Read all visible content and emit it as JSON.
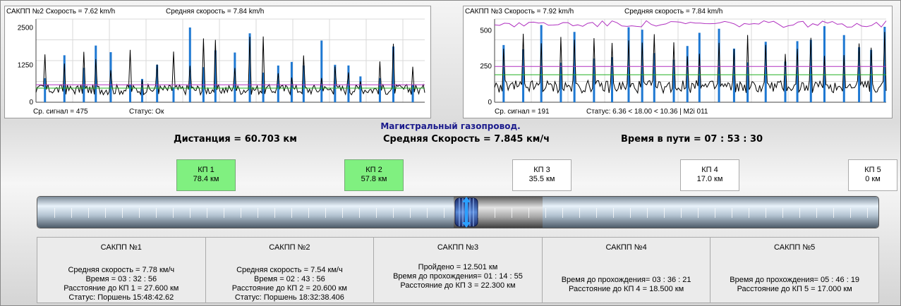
{
  "charts": [
    {
      "title_left": "САКПП №2  Скорость = 7.62 km/h",
      "title_right": "Средняя скорость = 7.84 km/h",
      "y_ticks": [
        "2500",
        "1250",
        "0"
      ],
      "y_max": 2800,
      "footer_signal": "Ср. сигнал = 475",
      "footer_status": "Статус: Ок"
    },
    {
      "title_left": "САКПП №3  Скорость = 7.92 km/h",
      "title_right": "Средняя скорость = 7.84 km/h",
      "y_ticks": [
        "500",
        "250",
        "0"
      ],
      "y_max": 580,
      "footer_signal": "Ср. сигнал = 191",
      "footer_status": "Статус: 6.36 < 18.00 < 10.36 | M2i 011"
    }
  ],
  "pipeline_title": "Магистральный газопровод.",
  "stats": {
    "distance": "Дистанция = 60.703 км",
    "avg_speed": "Средняя Скорость = 7.845 км/ч",
    "travel_time": "Время в пути = 07 : 53 : 30"
  },
  "kp_markers": [
    {
      "name": "КП 1",
      "distance": "78.4 км",
      "passed": true
    },
    {
      "name": "КП 2",
      "distance": "57.8 км",
      "passed": true
    },
    {
      "name": "КП 3",
      "distance": "35.5 км",
      "passed": false
    },
    {
      "name": "КП 4",
      "distance": "17.0 км",
      "passed": false
    },
    {
      "name": "КП 5",
      "distance": "0 км",
      "passed": false
    }
  ],
  "pig_progress": 0.51,
  "panels": [
    {
      "title": "САКПП №1",
      "lines": [
        "Средняя скорость = 7.78 км/ч",
        "Время = 03 : 32 : 56",
        "Расстояние до КП 1 = 27.600 км",
        "Статус: Поршень 15:48:42.62"
      ]
    },
    {
      "title": "САКПП №2",
      "lines": [
        "Средняя скорость = 7.54 км/ч",
        "Время = 02 : 43 : 56",
        "Расстояние до КП 2 = 20.600 км",
        "Статус: Поршень 18:32:38.406"
      ]
    },
    {
      "title": "САКПП №3",
      "lines": [
        "Пройдено = 12.501 км",
        "Время до прохождения= 01 : 14 : 55",
        "Расстояние до КП 3 = 22.300 км"
      ]
    },
    {
      "title": "САКПП №4",
      "lines": [
        "Время до прохождения= 03 : 36 : 21",
        "Расстояние до КП 4 = 18.500 км"
      ]
    },
    {
      "title": "САКПП №5",
      "lines": [
        "Время до прохождения= 05 : 46 : 19",
        "Расстояние до КП 5 = 17.000 км"
      ]
    }
  ],
  "colors": {
    "signal": "#000000",
    "peaks": "#1e78d2",
    "avg_line": "#b030c0",
    "threshold_line": "#20b020",
    "grid": "#d8d8d8",
    "kp_passed": "#80f080",
    "title_blue": "#1a1a8c"
  }
}
